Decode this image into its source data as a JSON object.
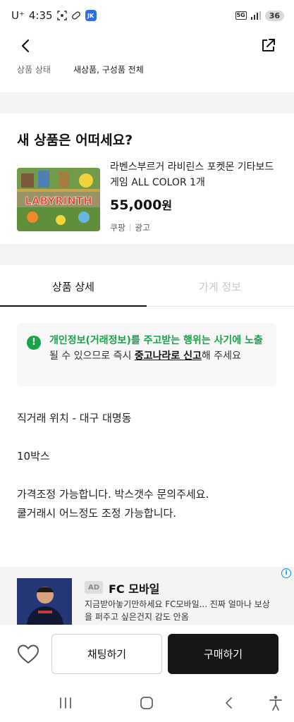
{
  "status_bar": {
    "carrier": "U⁺",
    "time": "4:35",
    "app_badge": "JK",
    "network": "5G",
    "battery": "36"
  },
  "nav": {
    "back_icon": "chevron-left-icon",
    "share_icon": "share-icon"
  },
  "condition": {
    "label": "상품 상태",
    "value": "새상품, 구성품 전체"
  },
  "recommendation": {
    "title": "새 상품은 어떠세요?",
    "product_name": "라벤스부르거 라비린스 포켓몬 기타보드게임  ALL COLOR  1개",
    "price": "55,000",
    "price_unit": "원",
    "seller": "쿠팡",
    "ad_label": "광고",
    "image_text": "LABYRINTH"
  },
  "tabs": [
    {
      "label": "상품 상세",
      "active": true
    },
    {
      "label": "가게 정보",
      "active": false
    }
  ],
  "notice": {
    "part1": "개인정보(거래정보)를 주고받는 행위는 사기에 노출",
    "part2": "될 수 있으므로 즉시 ",
    "link": "중고나라로 신고",
    "part3": "해 주세요"
  },
  "description": {
    "line1": "직거래 위치 - 대구 대명동",
    "line2": "10박스",
    "line3": "가격조정 가능합니다. 박스갯수 문의주세요.",
    "line4": "쿨거래시 어느정도 조정 가능합니다."
  },
  "ad": {
    "badge": "AD",
    "title": "FC 모바일",
    "description": "지금받아놓기만하세요 FC모바일... 진짜 얼마나 보상을 퍼주고 싶은건지 감도 안옴"
  },
  "actions": {
    "like_icon": "heart-icon",
    "chat_label": "채팅하기",
    "buy_label": "구매하기"
  },
  "colors": {
    "notice_green": "#19a34a",
    "buy_button": "#161616",
    "ad_info_blue": "#1a8fd8"
  }
}
